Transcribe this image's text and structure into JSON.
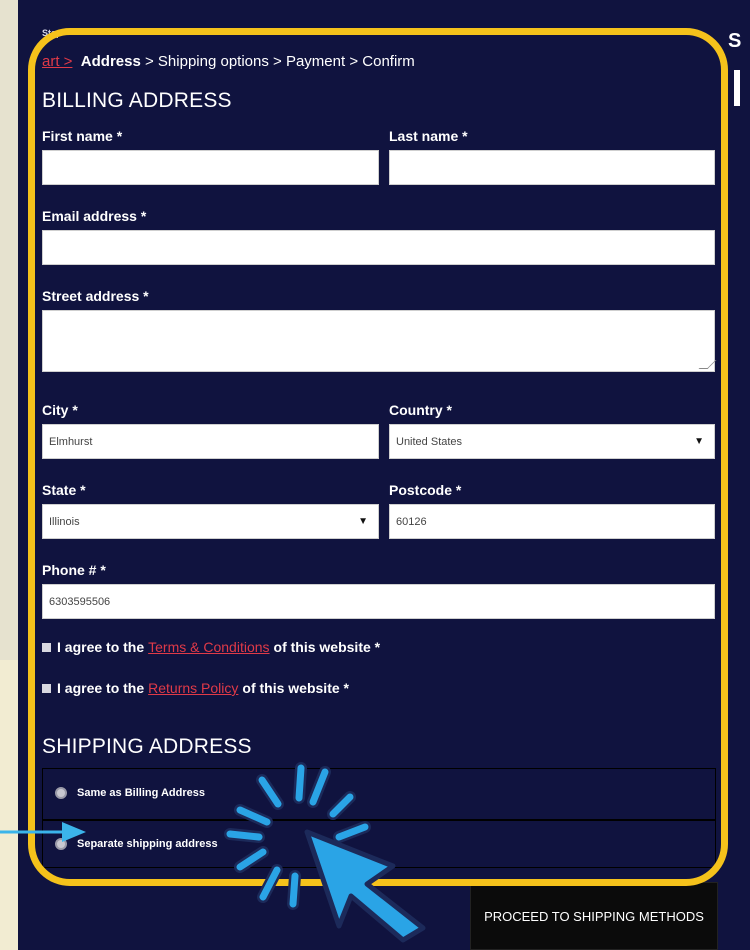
{
  "page": {
    "step_label": "Step",
    "side_letter": "S"
  },
  "breadcrumb": {
    "cart": "art >",
    "address": "Address",
    "sep": ">",
    "shipping": "Shipping options",
    "payment": "Payment",
    "confirm": "Confirm"
  },
  "billing": {
    "heading": "BILLING ADDRESS",
    "first_name_label": "First name *",
    "first_name_value": "",
    "last_name_label": "Last name *",
    "last_name_value": "",
    "email_label": "Email address *",
    "email_value": "",
    "street_label": "Street address *",
    "street_value": "",
    "city_label": "City *",
    "city_value": "Elmhurst",
    "country_label": "Country *",
    "country_value": "United States",
    "state_label": "State *",
    "state_value": "Illinois",
    "postcode_label": "Postcode *",
    "postcode_value": "60126",
    "phone_label": "Phone # *",
    "phone_value": "6303595506"
  },
  "agreements": {
    "terms_prefix": "I agree to the",
    "terms_link": "Terms & Conditions",
    "terms_suffix": "of this website *",
    "returns_prefix": "I agree to the",
    "returns_link": "Returns Policy",
    "returns_suffix": "of this website *"
  },
  "shipping": {
    "heading": "SHIPPING ADDRESS",
    "option_same": "Same as Billing Address",
    "option_separate": "Separate shipping address"
  },
  "actions": {
    "proceed_label": "PROCEED TO SHIPPING METHODS"
  },
  "colors": {
    "panel": "#10133f",
    "frame": "#f5c21b",
    "link": "#e03a48",
    "pointer": "#2aa4e6"
  },
  "icons": [
    "click-burst-icon",
    "pointer-arrow-icon",
    "left-arrow-icon",
    "dropdown-caret-icon"
  ]
}
